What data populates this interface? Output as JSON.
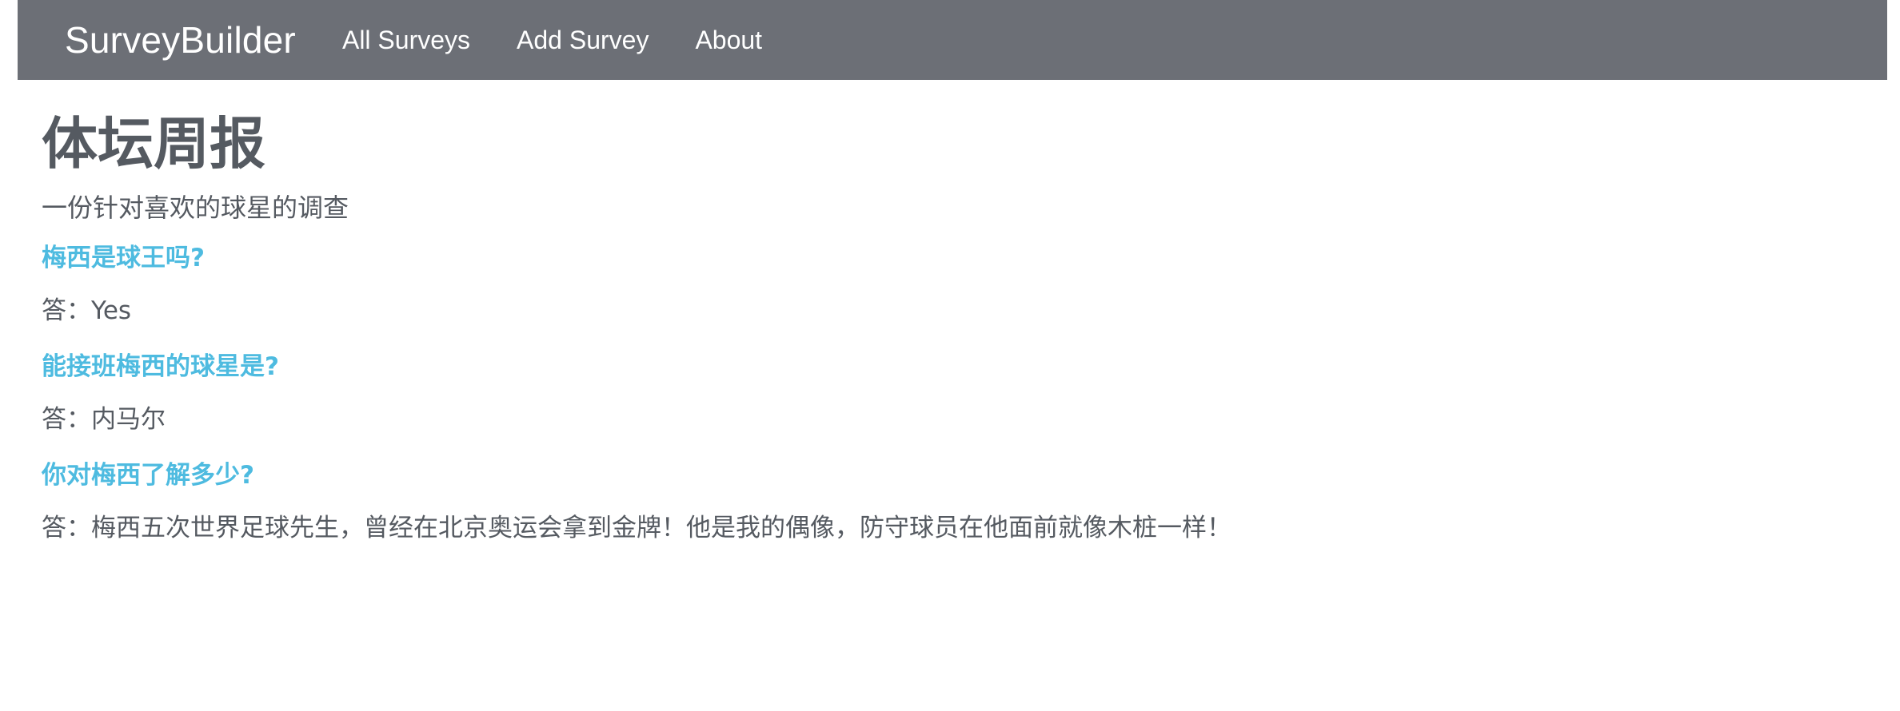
{
  "nav": {
    "brand": "SurveyBuilder",
    "links": [
      {
        "label": "All Surveys"
      },
      {
        "label": "Add Survey"
      },
      {
        "label": "About"
      }
    ]
  },
  "survey": {
    "title": "体坛周报",
    "description": "一份针对喜欢的球星的调查",
    "items": [
      {
        "question": "梅西是球王吗?",
        "answer": "答：Yes"
      },
      {
        "question": "能接班梅西的球星是?",
        "answer": "答：内马尔"
      },
      {
        "question": "你对梅西了解多少?",
        "answer": "答：梅西五次世界足球先生，曾经在北京奥运会拿到金牌！他是我的偶像，防守球员在他面前就像木桩一样！"
      }
    ]
  },
  "colors": {
    "navbar_bg": "#6c6f76",
    "question_color": "#4ebbe0",
    "text_color": "#555a61"
  }
}
